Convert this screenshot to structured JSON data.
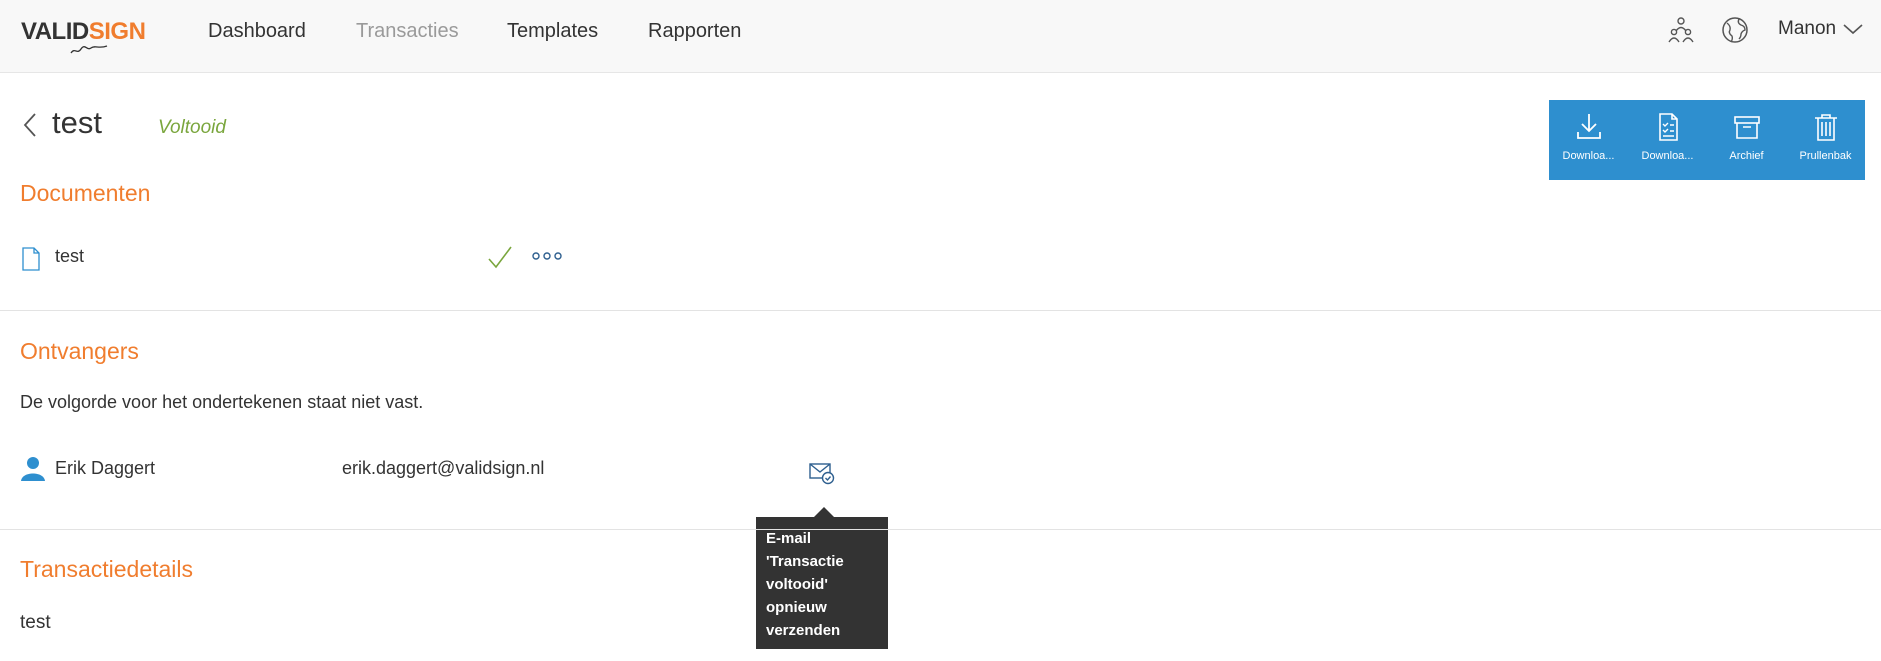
{
  "header": {
    "logo": {
      "part1": "VALID",
      "part2": "SIGN"
    },
    "nav": [
      {
        "label": "Dashboard",
        "active": false
      },
      {
        "label": "Transacties",
        "active": true
      },
      {
        "label": "Templates",
        "active": false
      },
      {
        "label": "Rapporten",
        "active": false
      }
    ],
    "icons": [
      "team-icon",
      "globe-icon"
    ],
    "user": {
      "name": "Manon"
    }
  },
  "transaction": {
    "title": "test",
    "status": "Voltooid"
  },
  "actions": [
    {
      "label": "Downloa...",
      "icon": "download-icon"
    },
    {
      "label": "Downloa...",
      "icon": "document-checklist-icon"
    },
    {
      "label": "Archief",
      "icon": "archive-icon"
    },
    {
      "label": "Prullenbak",
      "icon": "trash-icon"
    }
  ],
  "documents": {
    "title": "Documenten",
    "items": [
      {
        "name": "test",
        "status_icon": "checkmark-icon",
        "menu_icon": "more-options-icon"
      }
    ]
  },
  "recipients": {
    "title": "Ontvangers",
    "note": "De volgorde voor het ondertekenen staat niet vast.",
    "items": [
      {
        "name": "Erik Daggert",
        "email": "erik.daggert@validsign.nl"
      }
    ]
  },
  "tooltip": {
    "lines": [
      "E-mail",
      "'Transactie",
      "voltooid'",
      "opnieuw",
      "verzenden"
    ]
  },
  "details": {
    "title": "Transactiedetails",
    "value": "test"
  },
  "colors": {
    "accent": "#f07d2e",
    "primary": "#2e8fcf",
    "success": "#7aa63d",
    "tooltip_bg": "#333333"
  }
}
